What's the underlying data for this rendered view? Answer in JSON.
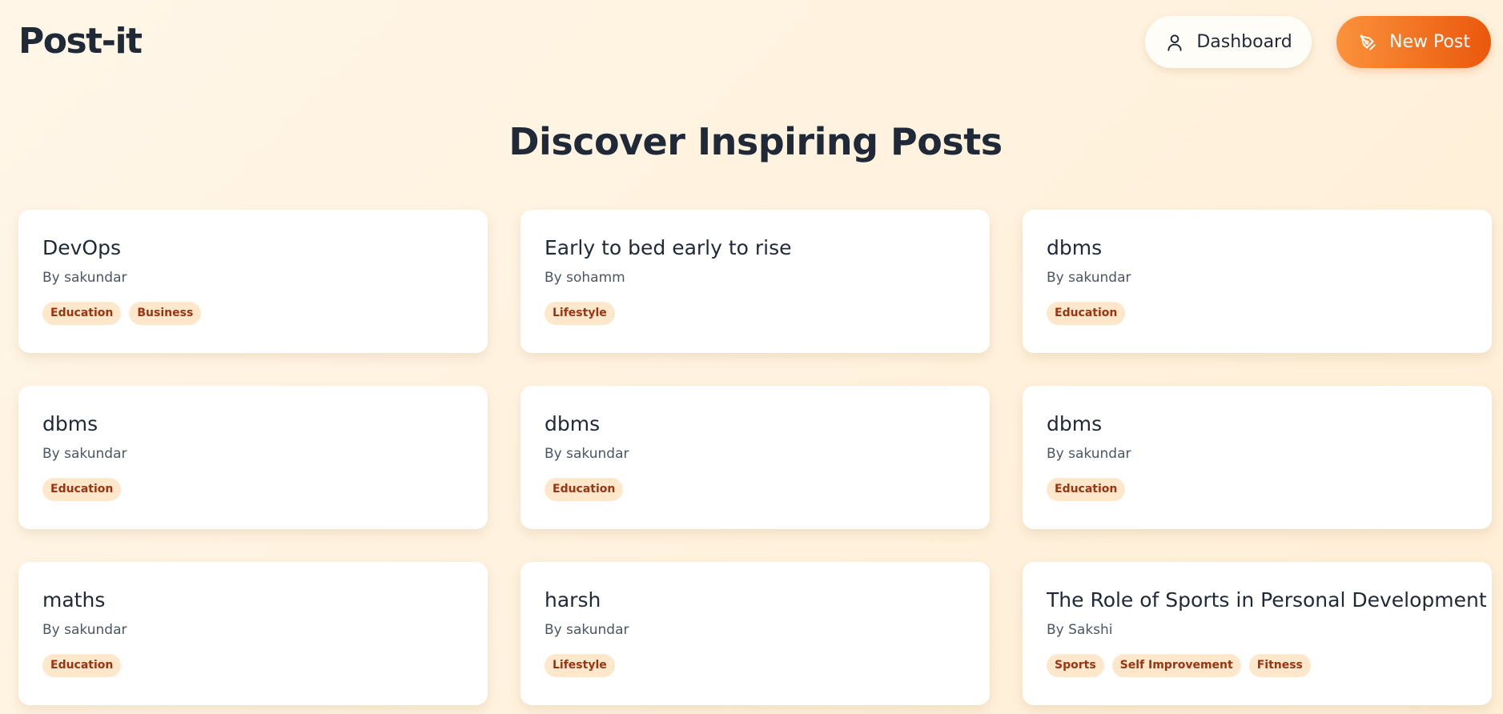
{
  "header": {
    "logo": "Post-it",
    "dashboard_label": "Dashboard",
    "dashboard_icon": "user-icon",
    "new_post_label": "New Post",
    "new_post_icon": "pen-icon"
  },
  "main": {
    "title": "Discover Inspiring Posts"
  },
  "posts": [
    {
      "title": "DevOps",
      "author": "By sakundar",
      "tags": [
        "Education",
        "Business"
      ]
    },
    {
      "title": "Early to bed early to rise",
      "author": "By sohamm",
      "tags": [
        "Lifestyle"
      ]
    },
    {
      "title": "dbms",
      "author": "By sakundar",
      "tags": [
        "Education"
      ]
    },
    {
      "title": "dbms",
      "author": "By sakundar",
      "tags": [
        "Education"
      ]
    },
    {
      "title": "dbms",
      "author": "By sakundar",
      "tags": [
        "Education"
      ]
    },
    {
      "title": "dbms",
      "author": "By sakundar",
      "tags": [
        "Education"
      ]
    },
    {
      "title": "maths",
      "author": "By sakundar",
      "tags": [
        "Education"
      ]
    },
    {
      "title": "harsh",
      "author": "By sakundar",
      "tags": [
        "Lifestyle"
      ]
    },
    {
      "title": "The Role of Sports in Personal Development",
      "author": "By Sakshi",
      "tags": [
        "Sports",
        "Self Improvement",
        "Fitness"
      ]
    }
  ],
  "colors": {
    "accent_start": "#fb923c",
    "accent_end": "#ea580c",
    "tag_bg": "#ffe7cc",
    "tag_text": "#9a3412",
    "text_dark": "#1f2937"
  }
}
